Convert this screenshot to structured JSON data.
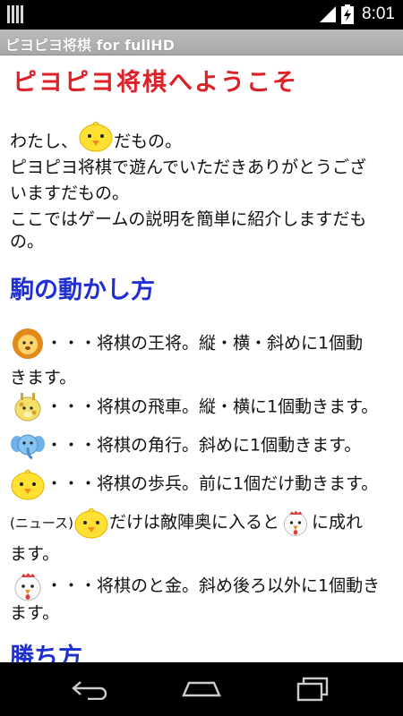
{
  "status_bar": {
    "time": "8:01"
  },
  "app": {
    "title": "ピヨピヨ将棋 for fullHD"
  },
  "welcome": {
    "heading": "ピヨピヨ将棋へようこそ"
  },
  "intro": {
    "line1_pre": "わたし、",
    "line1_post": "だもの。",
    "line2": "ピヨピヨ将棋で遊んでいただきありがとうござ",
    "line3": "いますだもの。",
    "line4": "ここではゲームの説明を簡単に紹介しますだも",
    "line5": "の。"
  },
  "moves": {
    "heading": "駒の動かし方",
    "lion_1": "・・・将棋の王将。縦・横・斜めに1個動",
    "lion_2": "きます。",
    "giraffe": "・・・将棋の飛車。縦・横に1個動きます。",
    "elephant": "・・・将棋の角行。斜めに1個動きます。",
    "chick": "・・・将棋の歩兵。前に1個だけ動きます。",
    "promo_prefix": "(ニュース)",
    "promo_mid": "だけは敵陣奥に入ると",
    "promo_suffix": "に成れ",
    "promo_2": "ます。",
    "hen_1": "・・・将棋のと金。斜め後ろ以外に1個動き",
    "hen_2": "ます。"
  },
  "win": {
    "heading": "勝ち方"
  },
  "icons": [
    "chick-icon",
    "lion-icon",
    "giraffe-icon",
    "elephant-icon",
    "hen-icon"
  ],
  "colors": {
    "red_heading": "#dd2127",
    "blue_heading": "#1f2fd0",
    "title_bar": "#b4b4b4"
  }
}
